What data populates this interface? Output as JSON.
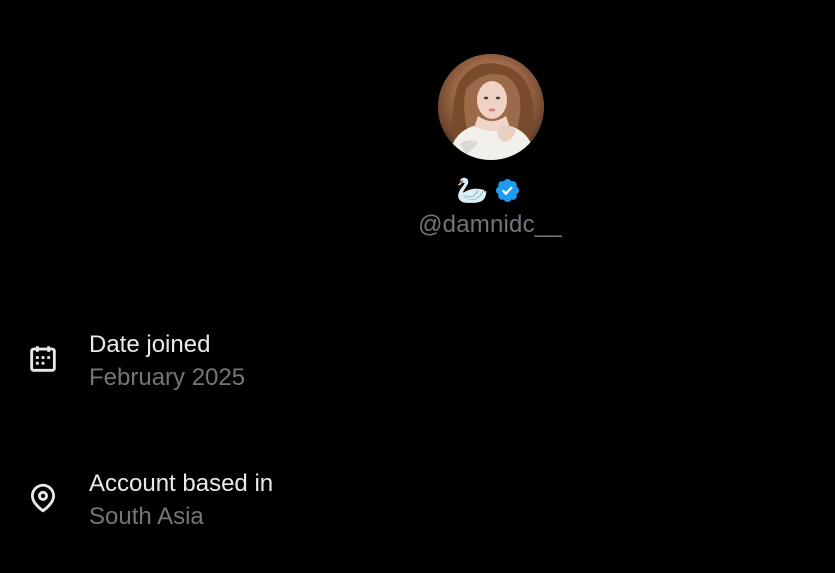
{
  "profile": {
    "display_name": "🦢",
    "handle": "@damnidc__",
    "verified": true,
    "badge_color": "#1d9bf0"
  },
  "about": {
    "date_joined": {
      "label": "Date joined",
      "value": "February 2025",
      "icon": "calendar-icon"
    },
    "location": {
      "label": "Account based in",
      "value": "South Asia",
      "icon": "location-pin-icon"
    }
  },
  "colors": {
    "background": "#000000",
    "primary_text": "#e7e9ea",
    "secondary_text": "#71767b"
  }
}
